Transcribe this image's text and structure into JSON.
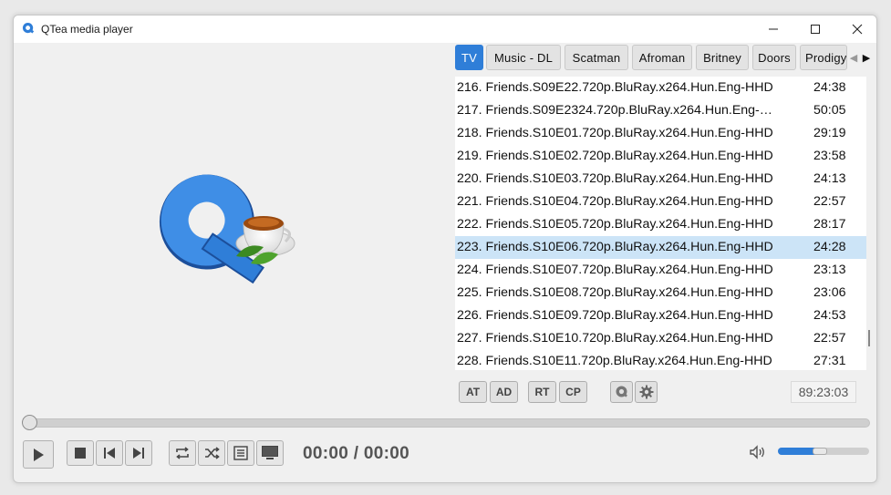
{
  "window": {
    "title": "QTea media player"
  },
  "tabs": [
    {
      "label": "TV",
      "active": true
    },
    {
      "label": "Music - DL",
      "active": false
    },
    {
      "label": "Scatman",
      "active": false
    },
    {
      "label": "Afroman",
      "active": false
    },
    {
      "label": "Britney",
      "active": false
    },
    {
      "label": "Doors",
      "active": false
    },
    {
      "label": "Prodigy",
      "active": false
    }
  ],
  "playlist": {
    "selected_index": 7,
    "items": [
      {
        "label": "216. Friends.S09E22.720p.BluRay.x264.Hun.Eng-HHD",
        "duration": "24:38"
      },
      {
        "label": "217. Friends.S09E2324.720p.BluRay.x264.Hun.Eng-…",
        "duration": "50:05"
      },
      {
        "label": "218. Friends.S10E01.720p.BluRay.x264.Hun.Eng-HHD",
        "duration": "29:19"
      },
      {
        "label": "219. Friends.S10E02.720p.BluRay.x264.Hun.Eng-HHD",
        "duration": "23:58"
      },
      {
        "label": "220. Friends.S10E03.720p.BluRay.x264.Hun.Eng-HHD",
        "duration": "24:13"
      },
      {
        "label": "221. Friends.S10E04.720p.BluRay.x264.Hun.Eng-HHD",
        "duration": "22:57"
      },
      {
        "label": "222. Friends.S10E05.720p.BluRay.x264.Hun.Eng-HHD",
        "duration": "28:17"
      },
      {
        "label": "223. Friends.S10E06.720p.BluRay.x264.Hun.Eng-HHD",
        "duration": "24:28"
      },
      {
        "label": "224. Friends.S10E07.720p.BluRay.x264.Hun.Eng-HHD",
        "duration": "23:13"
      },
      {
        "label": "225. Friends.S10E08.720p.BluRay.x264.Hun.Eng-HHD",
        "duration": "23:06"
      },
      {
        "label": "226. Friends.S10E09.720p.BluRay.x264.Hun.Eng-HHD",
        "duration": "24:53"
      },
      {
        "label": "227. Friends.S10E10.720p.BluRay.x264.Hun.Eng-HHD",
        "duration": "22:57"
      },
      {
        "label": "228. Friends.S10E11.720p.BluRay.x264.Hun.Eng-HHD",
        "duration": "27:31"
      }
    ]
  },
  "playlist_buttons": {
    "at": "AT",
    "ad": "AD",
    "rt": "RT",
    "cp": "CP"
  },
  "total_time": "89:23:03",
  "player": {
    "current_time": "00:00",
    "separator": "/",
    "total_time": "00:00",
    "seek_fraction": 0,
    "volume_fraction": 0.48
  },
  "colors": {
    "accent": "#2f7ed8",
    "selection": "#cce4f7"
  },
  "icons": {
    "app": "app-logo-icon",
    "minimize": "minimize-icon",
    "maximize": "maximize-icon",
    "close": "close-icon",
    "play": "play-icon",
    "stop": "stop-icon",
    "prev": "skip-previous-icon",
    "next": "skip-next-icon",
    "repeat": "repeat-icon",
    "shuffle": "shuffle-icon",
    "playlist": "playlist-icon",
    "screen": "fullscreen-icon",
    "volume": "volume-icon",
    "settings": "gear-icon",
    "qtea": "qtea-logo-icon"
  }
}
